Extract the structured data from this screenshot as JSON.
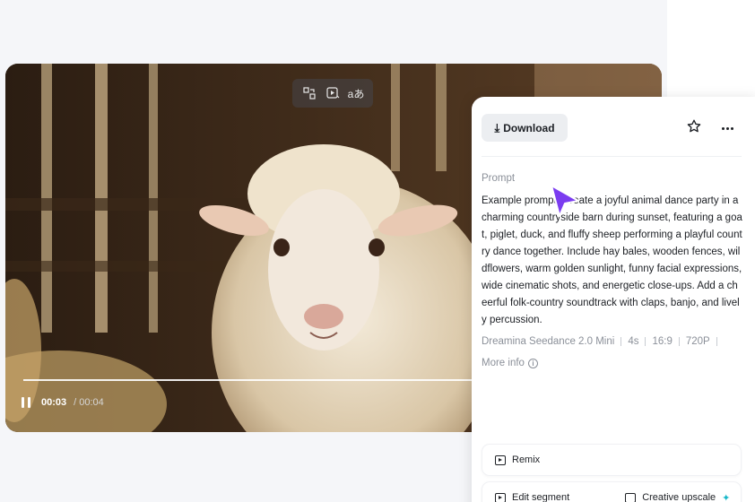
{
  "player": {
    "current_time": "00:03",
    "total_time": "/ 00:04",
    "progress": 0.75,
    "toolbar_icons": [
      "compare-icon",
      "play-extend-icon",
      "translate-icon"
    ],
    "translate_label": "aあ"
  },
  "panel": {
    "download_label": "Download",
    "prompt_label": "Prompt",
    "prompt_text": "Example prompt: Create a joyful animal dance party in a charming countryside barn during sunset, featuring a goat, piglet, duck, and fluffy sheep performing a playful country dance together. Include hay bales, wooden fences, wildflowers, warm golden sunlight, funny facial expressions, wide cinematic shots, and energetic close-ups. Add a cheerful folk-country soundtrack with claps, banjo, and lively percussion.",
    "meta": {
      "model": "Dreamina Seedance 2.0 Mini",
      "duration": "4s",
      "ratio": "16:9",
      "resolution": "720P"
    },
    "more_info_label": "More info",
    "remix_label": "Remix",
    "edit_segment_label": "Edit segment",
    "creative_upscale_label": "Creative upscale"
  },
  "colors": {
    "accent_cursor": "#7b3cf0",
    "sparkle": "#19b8c9"
  }
}
